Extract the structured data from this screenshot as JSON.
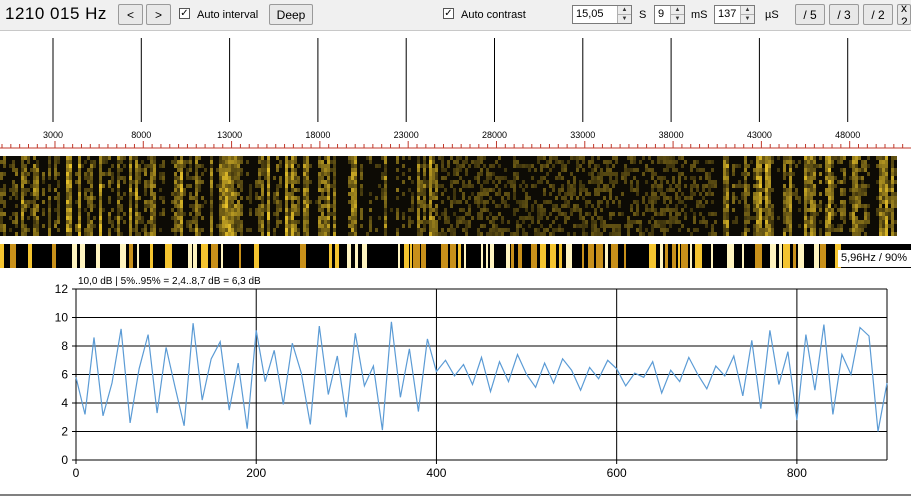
{
  "toolbar": {
    "frequency": "1210 015 Hz",
    "prev_label": "<",
    "next_label": ">",
    "auto_interval_checked": true,
    "auto_interval_label": "Auto interval",
    "deep_label": "Deep",
    "auto_contrast_checked": true,
    "auto_contrast_label": "Auto contrast",
    "seconds_value": "15,05",
    "seconds_unit": "S",
    "ms_value": "9",
    "ms_unit": "mS",
    "us_value": "137",
    "us_unit": "µS",
    "div5_label": "/ 5",
    "div3_label": "/ 3",
    "div2_label": "/ 2",
    "mult_label": "x 2"
  },
  "scale": {
    "labels": [
      "3000",
      "8000",
      "13000",
      "18000",
      "23000",
      "28000",
      "33000",
      "38000",
      "43000",
      "48000"
    ]
  },
  "spectrum": {
    "rate_label": "5,96Hz / 90%"
  },
  "chart_data": {
    "type": "line",
    "title": "10,0 dB | 5%..95% = 2,4..8,7 dB = 6,3 dB",
    "xlim": [
      0,
      900
    ],
    "ylim": [
      0,
      12
    ],
    "x_ticks": [
      0,
      200,
      400,
      600,
      800
    ],
    "y_ticks": [
      0,
      2,
      4,
      6,
      8,
      10,
      12
    ],
    "series": [
      {
        "color": "#5b9bd5",
        "x_step": 10,
        "values": [
          5.8,
          3.2,
          8.6,
          3.1,
          5.4,
          9.2,
          2.6,
          6.4,
          8.8,
          3.3,
          7.9,
          5.1,
          2.4,
          9.6,
          4.2,
          7.1,
          8.3,
          3.5,
          6.8,
          2.2,
          9.1,
          5.5,
          7.7,
          3.9,
          8.2,
          6.1,
          2.5,
          9.4,
          4.6,
          7.3,
          3.0,
          8.9,
          5.2,
          6.6,
          2.1,
          9.7,
          4.4,
          7.8,
          3.4,
          8.5,
          6.2,
          7.0,
          5.9,
          6.7,
          5.3,
          7.2,
          4.8,
          6.9,
          5.5,
          7.4,
          6.0,
          5.1,
          6.8,
          5.4,
          7.1,
          6.3,
          4.9,
          6.5,
          5.7,
          7.0,
          6.4,
          5.2,
          6.1,
          5.8,
          6.9,
          4.7,
          6.3,
          5.5,
          7.2,
          6.0,
          5.0,
          6.6,
          5.9,
          7.3,
          4.5,
          8.4,
          3.6,
          9.1,
          5.3,
          7.6,
          2.8,
          8.8,
          4.9,
          9.5,
          3.2,
          7.4,
          6.0,
          9.3,
          8.7,
          2.0,
          5.4
        ]
      }
    ]
  },
  "colors": {
    "waterfall_dark": "#0d0b05",
    "waterfall_bright": "#e8c22a",
    "grid": "#000000",
    "tick_red": "#c0392b"
  }
}
